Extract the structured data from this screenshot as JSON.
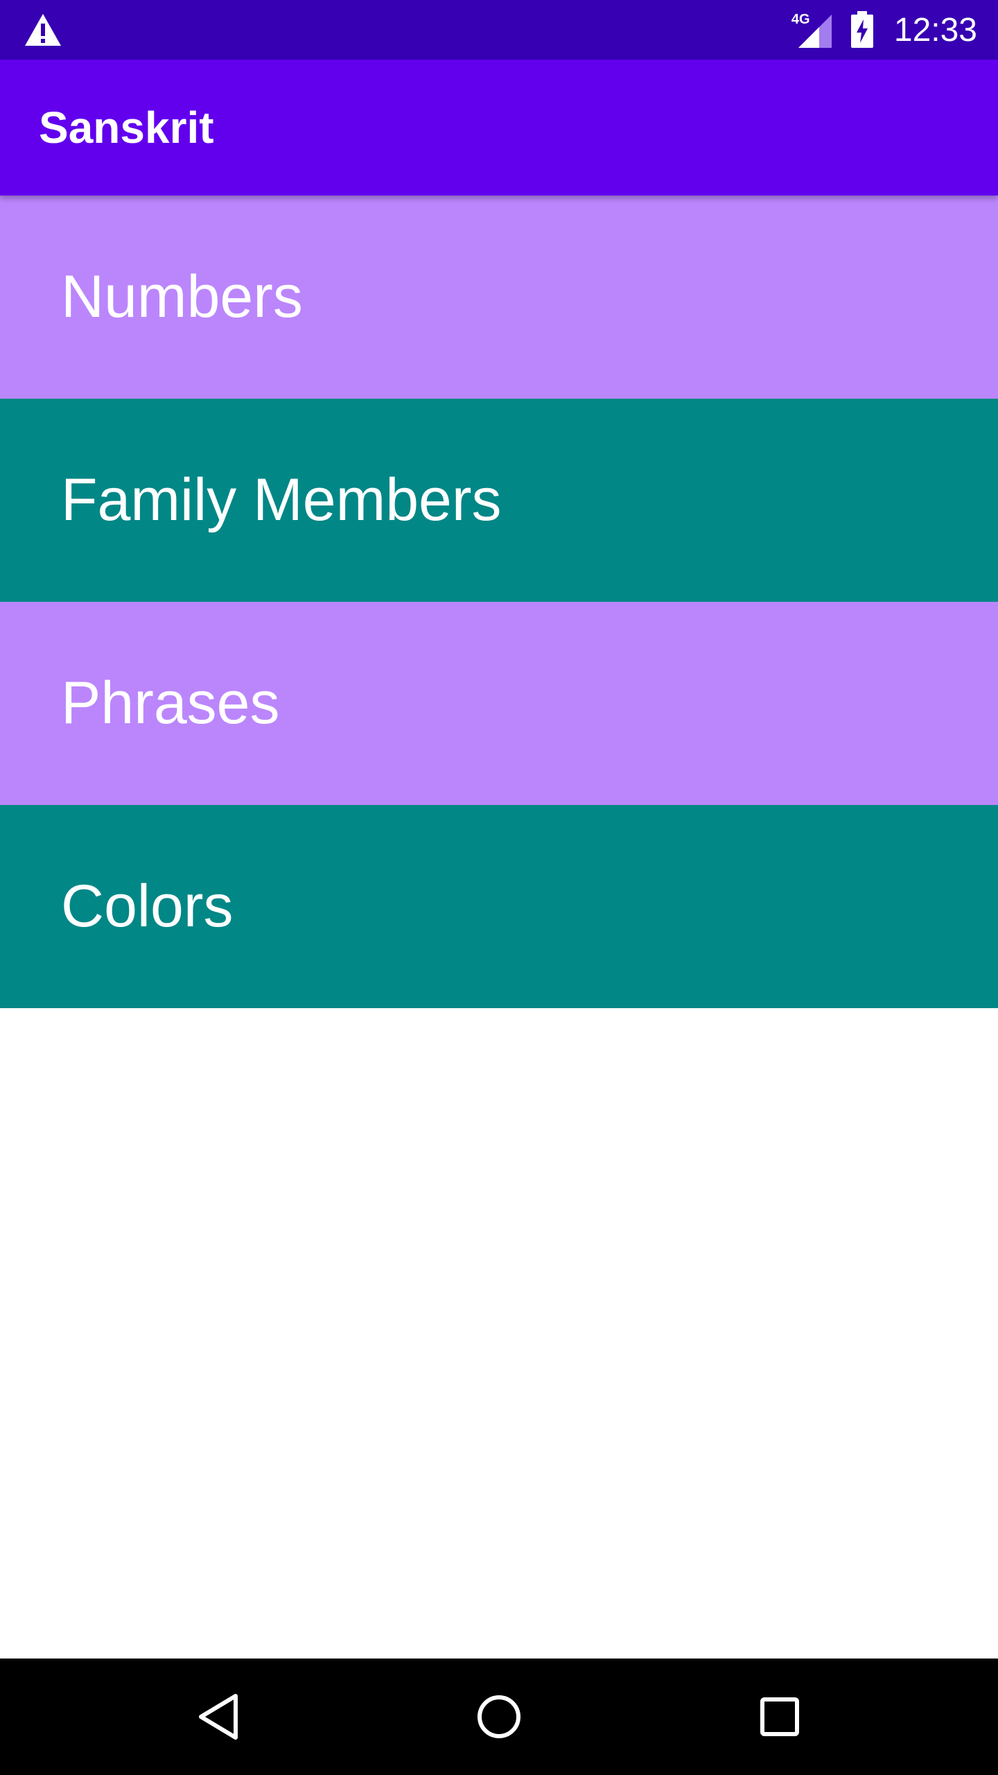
{
  "status_bar": {
    "time": "12:33",
    "network_type": "4G",
    "icons": [
      "alert-icon",
      "signal-icon",
      "battery-charging-icon"
    ],
    "background_color": "#3700b3"
  },
  "app_bar": {
    "title": "Sanskrit",
    "background_color": "#6200ee"
  },
  "categories": [
    {
      "label": "Numbers",
      "color": "#bb86fc"
    },
    {
      "label": "Family Members",
      "color": "#018786"
    },
    {
      "label": "Phrases",
      "color": "#bb86fc"
    },
    {
      "label": "Colors",
      "color": "#018786"
    }
  ],
  "nav_bar": {
    "icons": [
      "back-icon",
      "home-icon",
      "recents-icon"
    ]
  }
}
